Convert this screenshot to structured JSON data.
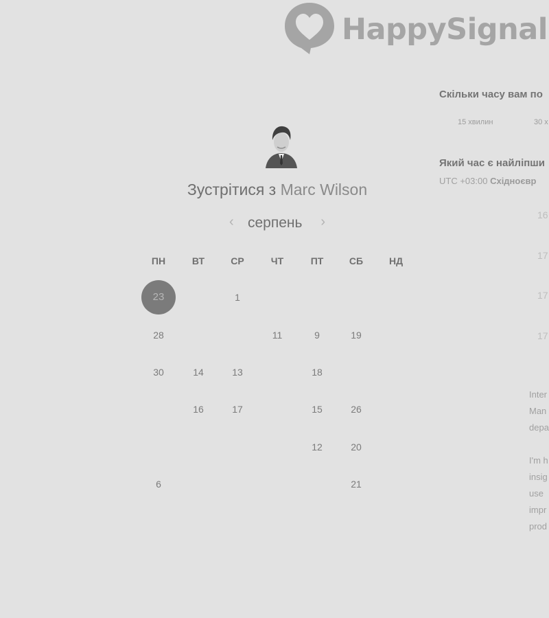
{
  "logo": {
    "text": "HappySignals",
    "icon": "speech-heart-icon"
  },
  "host": {
    "title_prefix": "Зустрітися з",
    "name": "Marc Wilson"
  },
  "calendar": {
    "month": "серпень",
    "prev_icon": "chevron-left-icon",
    "next_icon": "chevron-right-icon",
    "weekdays": [
      "ПН",
      "ВТ",
      "СР",
      "ЧТ",
      "ПТ",
      "СБ",
      "НД"
    ],
    "selected_day": "23",
    "days": [
      [
        "23",
        "",
        "1",
        "",
        "",
        "",
        ""
      ],
      [
        "28",
        "",
        "",
        "11",
        "9",
        "19",
        ""
      ],
      [
        "30",
        "14",
        "13",
        "",
        "18",
        "",
        ""
      ],
      [
        "",
        "16",
        "17",
        "",
        "15",
        "26",
        ""
      ],
      [
        "",
        "",
        "",
        "",
        "12",
        "20",
        ""
      ],
      [
        "6",
        "",
        "",
        "",
        "",
        "21",
        ""
      ]
    ]
  },
  "booking": {
    "duration_question": "Скільки часу вам по",
    "durations": [
      "15 хвилин",
      "30 х"
    ],
    "time_question": "Який час є найліпши",
    "timezone_offset": "UTC +03:00",
    "timezone_name": "Східноєвр",
    "slots": [
      "16",
      "17",
      "17",
      "17"
    ]
  },
  "description": {
    "paragraph1": [
      "Inter",
      "Man",
      "depa"
    ],
    "paragraph2": [
      "I'm h",
      "insig",
      "use",
      "impr",
      "prod"
    ]
  },
  "colors": {
    "background": "#e2e2e2",
    "selected_day": "#7b7b7b",
    "logo": "#a5a5a5"
  }
}
